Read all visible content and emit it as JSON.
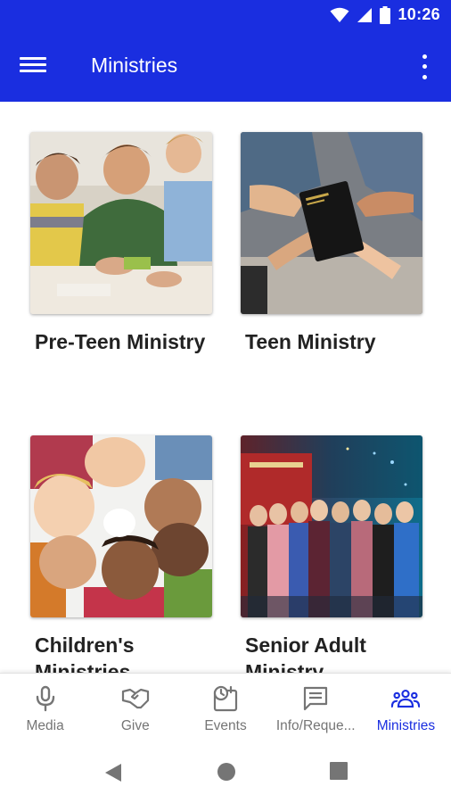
{
  "status_bar": {
    "time": "10:26"
  },
  "app_bar": {
    "title": "Ministries"
  },
  "ministries": [
    {
      "label": "Pre-Teen Ministry"
    },
    {
      "label": "Teen Ministry"
    },
    {
      "label": "Children's Ministries"
    },
    {
      "label": "Senior Adult Ministry"
    }
  ],
  "bottom_nav": {
    "items": [
      {
        "label": "Media",
        "icon": "microphone-icon"
      },
      {
        "label": "Give",
        "icon": "handshake-icon"
      },
      {
        "label": "Events",
        "icon": "calendar-clock-icon"
      },
      {
        "label": "Info/Reque...",
        "icon": "message-icon"
      },
      {
        "label": "Ministries",
        "icon": "group-icon"
      }
    ],
    "active": "Ministries"
  },
  "colors": {
    "primary": "#1a2ee0",
    "inactive": "#757575"
  }
}
